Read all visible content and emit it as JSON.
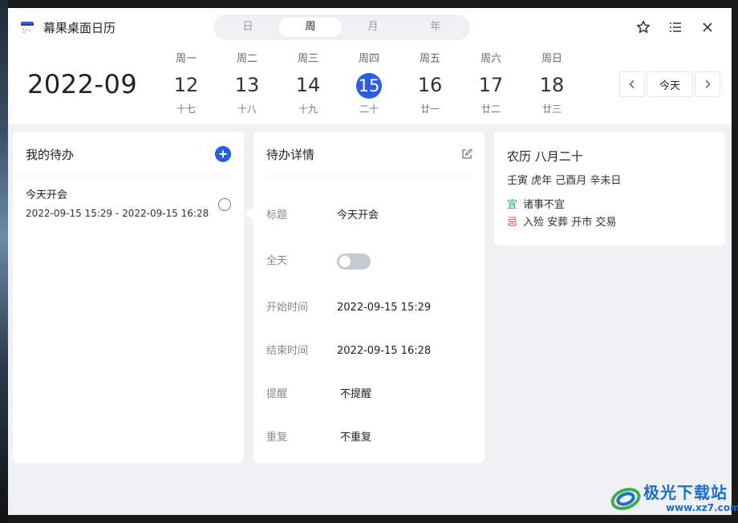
{
  "app": {
    "title": "幕果桌面日历"
  },
  "view_tabs": [
    {
      "label": "日",
      "active": false
    },
    {
      "label": "周",
      "active": true
    },
    {
      "label": "月",
      "active": false
    },
    {
      "label": "年",
      "active": false
    }
  ],
  "toolbar": {
    "icons": [
      "star-icon",
      "list-icon",
      "close-icon"
    ]
  },
  "header": {
    "year_month": "2022-09"
  },
  "week": [
    {
      "weekday": "周一",
      "day": "12",
      "lunar": "十七",
      "today": false
    },
    {
      "weekday": "周二",
      "day": "13",
      "lunar": "十八",
      "today": false
    },
    {
      "weekday": "周三",
      "day": "14",
      "lunar": "十九",
      "today": false
    },
    {
      "weekday": "周四",
      "day": "15",
      "lunar": "二十",
      "today": true
    },
    {
      "weekday": "周五",
      "day": "16",
      "lunar": "廿一",
      "today": false
    },
    {
      "weekday": "周六",
      "day": "17",
      "lunar": "廿二",
      "today": false
    },
    {
      "weekday": "周日",
      "day": "18",
      "lunar": "廿三",
      "today": false
    }
  ],
  "nav": {
    "today_label": "今天"
  },
  "todo": {
    "title": "我的待办",
    "items": [
      {
        "name": "今天开会",
        "time": "2022-09-15 15:29 - 2022-09-15 16:28"
      }
    ]
  },
  "detail": {
    "title": "待办详情",
    "title_label": "标题",
    "title_value": "今天开会",
    "allday_label": "全天",
    "allday_on": false,
    "start_label": "开始时间",
    "start_value": "2022-09-15 15:29",
    "end_label": "结束时间",
    "end_value": "2022-09-15 16:28",
    "remind_label": "提醒",
    "remind_value": "不提醒",
    "repeat_label": "重复",
    "repeat_value": "不重复"
  },
  "almanac": {
    "lunar_date": "农历 八月二十",
    "ganzhi": "壬寅 虎年 己酉月 辛未日",
    "yi_tag": "宜",
    "yi_text": "诸事不宜",
    "ji_tag": "忌",
    "ji_text": "入殓 安葬 开市 交易"
  },
  "watermark": {
    "text": "极光下载站",
    "url": "www.xz7.com"
  },
  "colors": {
    "accent": "#2b5ce6",
    "yi": "#18a58e",
    "ji": "#e0463c",
    "background": "#f0f1f5"
  }
}
